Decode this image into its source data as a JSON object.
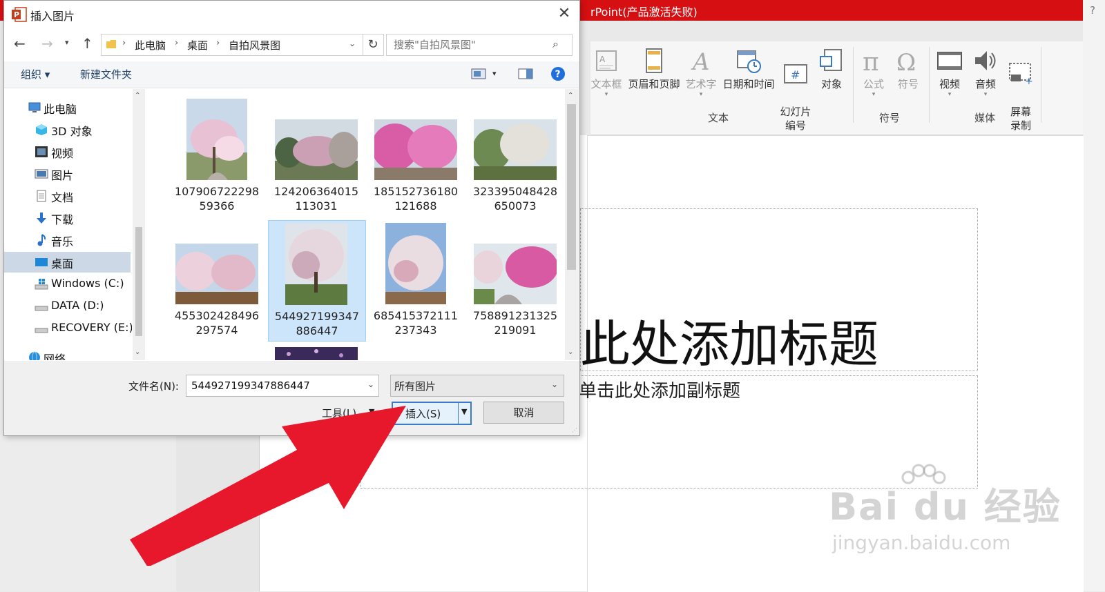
{
  "powerpoint": {
    "title_fragment": "rPoint(产品激活失败)",
    "help": "?",
    "ribbon": {
      "text_group": {
        "label": "文本",
        "items": [
          {
            "label": "文本框",
            "enabled": false
          },
          {
            "label": "页眉和页脚",
            "enabled": true
          },
          {
            "label": "艺术字",
            "enabled": false
          },
          {
            "label": "日期和时间",
            "enabled": true
          },
          {
            "label": "幻灯片\n编号",
            "enabled": true
          },
          {
            "label": "对象",
            "enabled": true
          }
        ]
      },
      "symbol_group": {
        "label": "符号",
        "items": [
          {
            "label": "公式",
            "enabled": false
          },
          {
            "label": "符号",
            "enabled": false
          }
        ]
      },
      "media_group": {
        "label": "媒体",
        "items": [
          {
            "label": "视频",
            "enabled": true
          },
          {
            "label": "音频",
            "enabled": true
          },
          {
            "label": "屏幕\n录制",
            "enabled": true
          }
        ]
      }
    },
    "slide": {
      "title_placeholder": "此处添加标题",
      "subtitle_placeholder": "单击此处添加副标题"
    },
    "watermark": {
      "brand": "Bai du 经验",
      "url": "jingyan.baidu.com"
    }
  },
  "dialog": {
    "title": "插入图片",
    "close": "✕",
    "breadcrumb": [
      "此电脑",
      "桌面",
      "自拍风景图"
    ],
    "search_placeholder": "搜索\"自拍风景图\"",
    "toolbar": {
      "organize": "组织 ▾",
      "new_folder": "新建文件夹"
    },
    "tree": [
      {
        "label": "此电脑",
        "icon": "computer-icon",
        "indent": 1
      },
      {
        "label": "3D 对象",
        "icon": "cube-3d-icon",
        "indent": 2
      },
      {
        "label": "视频",
        "icon": "video-folder-icon",
        "indent": 2
      },
      {
        "label": "图片",
        "icon": "pictures-folder-icon",
        "indent": 2
      },
      {
        "label": "文档",
        "icon": "document-icon",
        "indent": 2
      },
      {
        "label": "下载",
        "icon": "download-icon",
        "indent": 2
      },
      {
        "label": "音乐",
        "icon": "music-icon",
        "indent": 2
      },
      {
        "label": "桌面",
        "icon": "desktop-icon",
        "indent": 2,
        "selected": true
      },
      {
        "label": "Windows (C:)",
        "icon": "windows-drive-icon",
        "indent": 2
      },
      {
        "label": "DATA (D:)",
        "icon": "drive-icon",
        "indent": 2
      },
      {
        "label": "RECOVERY (E:)",
        "icon": "drive-icon",
        "indent": 2
      },
      {
        "label": "网络",
        "icon": "network-icon",
        "indent": 1
      }
    ],
    "files": [
      {
        "name1": "107906722298",
        "name2": "59366",
        "orientation": "portrait",
        "tint": "pink-white"
      },
      {
        "name1": "124206364015",
        "name2": "113031",
        "orientation": "landscape",
        "tint": "pink-grey"
      },
      {
        "name1": "185152736180",
        "name2": "121688",
        "orientation": "landscape",
        "tint": "magenta"
      },
      {
        "name1": "323395048428",
        "name2": "650073",
        "orientation": "landscape",
        "tint": "green-white"
      },
      {
        "name1": "455302428496",
        "name2": "297574",
        "orientation": "landscape",
        "tint": "pink-white"
      },
      {
        "name1": "544927199347",
        "name2": "886447",
        "orientation": "portrait",
        "tint": "white-pink",
        "selected": true
      },
      {
        "name1": "685415372111",
        "name2": "237343",
        "orientation": "portrait",
        "tint": "white-blue"
      },
      {
        "name1": "758891231325",
        "name2": "219091",
        "orientation": "landscape",
        "tint": "magenta-path"
      }
    ],
    "filename_label": "文件名(N):",
    "filename_value": "544927199347886447",
    "filter_value": "所有图片",
    "tools_label": "工具(L)",
    "insert_label": "插入(S)",
    "cancel_label": "取消"
  },
  "colors": {
    "pp_red": "#d50f12",
    "selection_blue": "#cce5fb",
    "tree_selected": "#ccd8e6",
    "arrow_red": "#e8182c"
  }
}
